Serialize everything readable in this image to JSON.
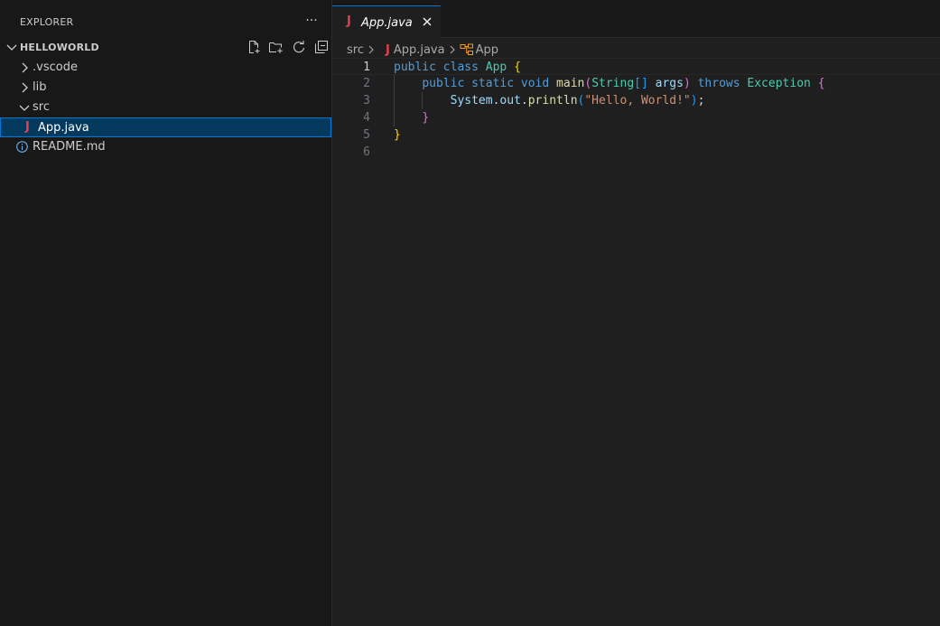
{
  "sidebar": {
    "header": "EXPLORER",
    "more_label": "···",
    "folder": {
      "title": "HELLOWORLD",
      "actions": [
        "new-file-icon",
        "new-folder-icon",
        "refresh-icon",
        "collapse-all-icon"
      ]
    },
    "tree": [
      {
        "label": ".vscode",
        "type": "folder",
        "expanded": false
      },
      {
        "label": "lib",
        "type": "folder",
        "expanded": false
      },
      {
        "label": "src",
        "type": "folder",
        "expanded": true
      },
      {
        "label": "App.java",
        "type": "java-file",
        "selected": true
      },
      {
        "label": "README.md",
        "type": "info-file"
      }
    ]
  },
  "editor": {
    "tab": {
      "icon_glyph": "J",
      "label": "App.java"
    },
    "breadcrumb": {
      "folder": "src",
      "file_glyph": "J",
      "file": "App.java",
      "symbol": "App"
    },
    "lines": [
      {
        "n": "1",
        "tokens": [
          [
            "kw",
            "public"
          ],
          [
            "pl",
            " "
          ],
          [
            "kw",
            "class"
          ],
          [
            "pl",
            " "
          ],
          [
            "ty",
            "App"
          ],
          [
            "pl",
            " "
          ],
          [
            "br1",
            "{"
          ]
        ]
      },
      {
        "n": "2",
        "tokens": [
          [
            "pl",
            "    "
          ],
          [
            "kw",
            "public"
          ],
          [
            "pl",
            " "
          ],
          [
            "kw",
            "static"
          ],
          [
            "pl",
            " "
          ],
          [
            "kw",
            "void"
          ],
          [
            "pl",
            " "
          ],
          [
            "fn",
            "main"
          ],
          [
            "br2",
            "("
          ],
          [
            "ty",
            "String"
          ],
          [
            "br3",
            "[]"
          ],
          [
            "pl",
            " "
          ],
          [
            "var",
            "args"
          ],
          [
            "br2",
            ")"
          ],
          [
            "pl",
            " "
          ],
          [
            "kw",
            "throws"
          ],
          [
            "pl",
            " "
          ],
          [
            "ty",
            "Exception"
          ],
          [
            "pl",
            " "
          ],
          [
            "br2",
            "{"
          ]
        ]
      },
      {
        "n": "3",
        "tokens": [
          [
            "pl",
            "        "
          ],
          [
            "var",
            "System"
          ],
          [
            "pl",
            "."
          ],
          [
            "var",
            "out"
          ],
          [
            "pl",
            "."
          ],
          [
            "fn",
            "println"
          ],
          [
            "br3",
            "("
          ],
          [
            "str",
            "\"Hello, World!\""
          ],
          [
            "br3",
            ")"
          ],
          [
            "pl",
            ";"
          ]
        ]
      },
      {
        "n": "4",
        "tokens": [
          [
            "pl",
            "    "
          ],
          [
            "br2",
            "}"
          ]
        ]
      },
      {
        "n": "5",
        "tokens": [
          [
            "br1",
            "}"
          ]
        ]
      },
      {
        "n": "6",
        "tokens": []
      }
    ]
  },
  "colors": {
    "accent": "#0078d4",
    "java_icon": "#e0434f",
    "selection": "#04395e"
  }
}
